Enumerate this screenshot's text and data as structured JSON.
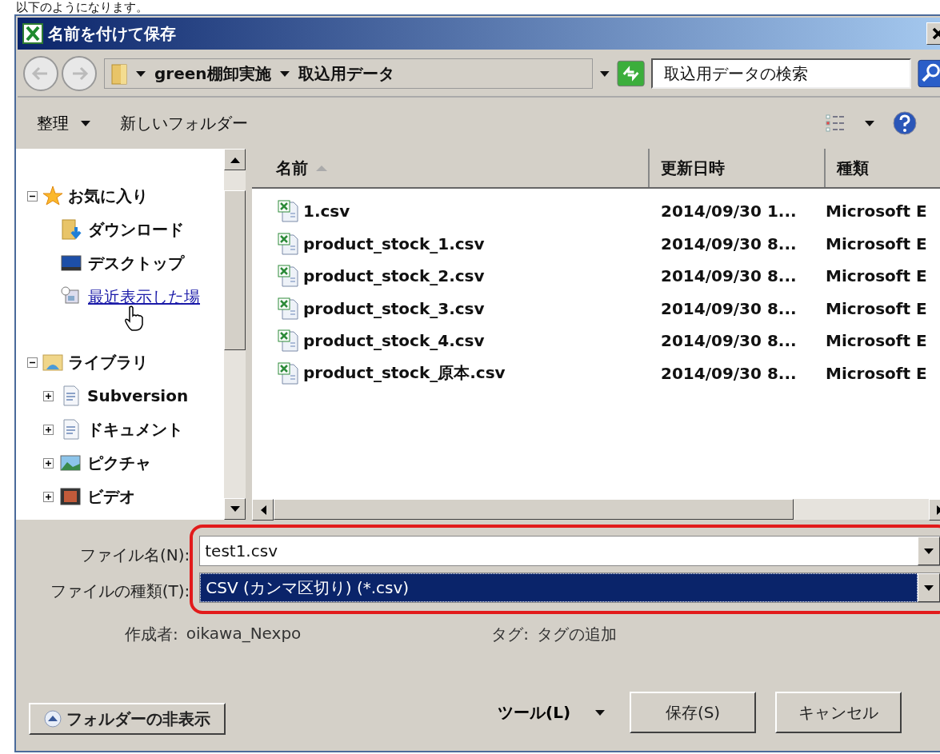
{
  "caption": "以下のようになります。",
  "window": {
    "title": "名前を付けて保存"
  },
  "nav": {
    "breadcrumbs": [
      "green棚卸実施",
      "取込用データ"
    ],
    "search": {
      "placeholder": "取込用データの検索"
    }
  },
  "toolbar": {
    "organize": "整理",
    "new_folder": "新しいフォルダー"
  },
  "sidebar": {
    "items": [
      {
        "label": "お気に入り",
        "kind": "star",
        "expanded": true,
        "children": [
          {
            "label": "ダウンロード",
            "kind": "download",
            "hover": false
          },
          {
            "label": "デスクトップ",
            "kind": "desktop",
            "hover": false
          },
          {
            "label": "最近表示した場",
            "kind": "recent",
            "hover": true
          }
        ]
      },
      {
        "label": "ライブラリ",
        "kind": "library",
        "expanded": true,
        "children": [
          {
            "label": "Subversion",
            "kind": "doc",
            "expanded": false
          },
          {
            "label": "ドキュメント",
            "kind": "doc",
            "expanded": false
          },
          {
            "label": "ピクチャ",
            "kind": "picture",
            "expanded": false
          },
          {
            "label": "ビデオ",
            "kind": "video",
            "expanded": false
          }
        ]
      }
    ]
  },
  "file_list": {
    "columns": [
      {
        "label": "名前",
        "sorted": true
      },
      {
        "label": "更新日時",
        "sorted": false
      },
      {
        "label": "種類",
        "sorted": false
      }
    ],
    "rows": [
      {
        "name": "1.csv",
        "modified": "2014/09/30 1...",
        "type": "Microsoft E"
      },
      {
        "name": "product_stock_1.csv",
        "modified": "2014/09/30 8...",
        "type": "Microsoft E"
      },
      {
        "name": "product_stock_2.csv",
        "modified": "2014/09/30 8...",
        "type": "Microsoft E"
      },
      {
        "name": "product_stock_3.csv",
        "modified": "2014/09/30 8...",
        "type": "Microsoft E"
      },
      {
        "name": "product_stock_4.csv",
        "modified": "2014/09/30 8...",
        "type": "Microsoft E"
      },
      {
        "name": "product_stock_原本.csv",
        "modified": "2014/09/30 8...",
        "type": "Microsoft E"
      }
    ]
  },
  "form": {
    "file_name": {
      "label": "ファイル名(N):",
      "value": "test1.csv"
    },
    "file_type": {
      "label": "ファイルの種類(T):",
      "value": "CSV (カンマ区切り) (*.csv)",
      "selected": true
    },
    "author": {
      "label": "作成者:",
      "value": "oikawa_Nexpo"
    },
    "tags": {
      "label": "タグ:",
      "value": "タグの追加"
    }
  },
  "buttons": {
    "hide_folders": "フォルダーの非表示",
    "tools": "ツール(L)",
    "save": "保存(S)",
    "cancel": "キャンセル"
  }
}
